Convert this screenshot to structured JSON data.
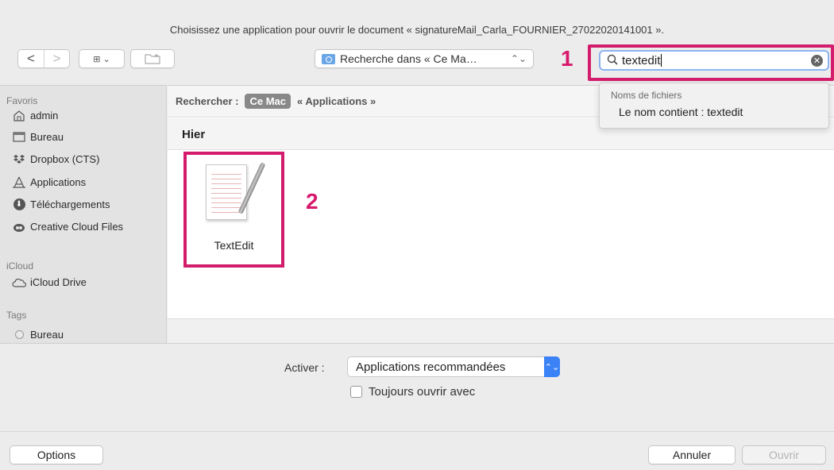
{
  "window": {
    "prompt": "Choisissez une application pour ouvrir le document « signatureMail_Carla_FOURNIER_27022020141001 »."
  },
  "toolbar": {
    "back": "<",
    "forward": ">",
    "view_label": "⊞ ⌄",
    "location_label": "Recherche dans « Ce Ma…",
    "location_chevron": "⌃⌄"
  },
  "annotations": {
    "one": "1",
    "two": "2"
  },
  "search": {
    "value": "textedit",
    "clear": "✕"
  },
  "suggestions": {
    "category": "Noms de fichiers",
    "option": "Le nom contient : textedit"
  },
  "sidebar": {
    "favoris_label": "Favoris",
    "favoris": [
      {
        "label": "admin",
        "icon": "home-icon"
      },
      {
        "label": "Bureau",
        "icon": "desktop-icon"
      },
      {
        "label": "Dropbox (CTS)",
        "icon": "dropbox-icon"
      },
      {
        "label": "Applications",
        "icon": "applications-icon"
      },
      {
        "label": "Téléchargements",
        "icon": "download-icon"
      },
      {
        "label": "Creative Cloud Files",
        "icon": "creative-cloud-icon"
      }
    ],
    "icloud_label": "iCloud",
    "icloud": [
      {
        "label": "iCloud Drive",
        "icon": "cloud-icon"
      }
    ],
    "tags_label": "Tags",
    "tags": [
      {
        "label": "Bureau",
        "icon": "tag-dot-icon"
      }
    ]
  },
  "scope": {
    "label": "Rechercher :",
    "active": "Ce Mac",
    "inactive": "« Applications »"
  },
  "results": {
    "section": "Hier",
    "items": [
      {
        "label": "TextEdit",
        "icon": "textedit-icon"
      }
    ]
  },
  "bottom": {
    "activate_label": "Activer :",
    "activate_value": "Applications recommandées",
    "always_open_label": "Toujours ouvrir avec",
    "options_button": "Options",
    "cancel_button": "Annuler",
    "open_button": "Ouvrir"
  },
  "colors": {
    "annotation": "#d31d6c",
    "accent": "#3b82f6"
  }
}
